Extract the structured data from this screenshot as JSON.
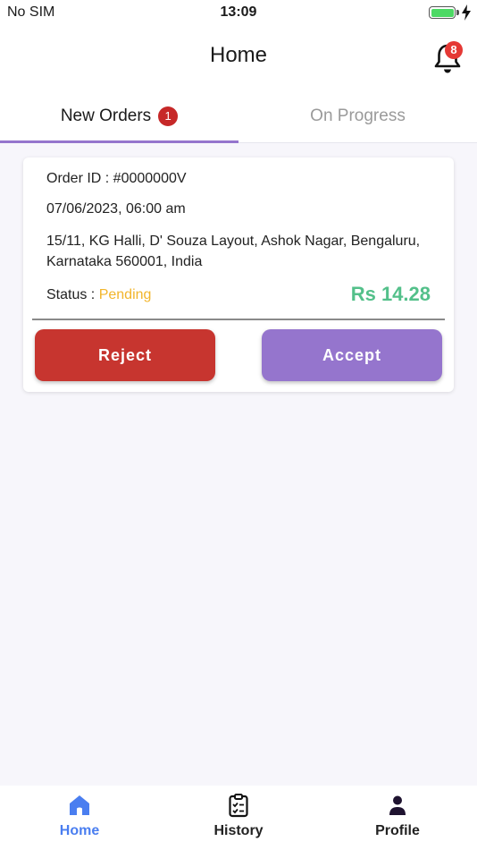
{
  "status_bar": {
    "carrier": "No SIM",
    "time": "13:09"
  },
  "header": {
    "title": "Home",
    "notification_count": "8"
  },
  "tabs": [
    {
      "label": "New Orders",
      "badge": "1",
      "active": true
    },
    {
      "label": "On Progress",
      "active": false
    }
  ],
  "order": {
    "id_text": "Order ID : #0000000V",
    "datetime": "07/06/2023, 06:00 am",
    "address": "15/11, KG Halli, D' Souza Layout, Ashok Nagar, Bengaluru, Karnataka 560001, India",
    "status_label": "Status : ",
    "status_value": "Pending",
    "amount": "Rs 14.28",
    "reject_label": "Reject",
    "accept_label": "Accept"
  },
  "bottom_nav": {
    "items": [
      {
        "label": "Home",
        "icon": "home-icon",
        "active": true
      },
      {
        "label": "History",
        "icon": "clipboard-icon",
        "active": false
      },
      {
        "label": "Profile",
        "icon": "person-icon",
        "active": false
      }
    ]
  },
  "colors": {
    "accent": "#9575cd",
    "reject": "#c7352f",
    "amount": "#53c08a",
    "pending": "#f2b52b",
    "nav_active": "#4a7ef0",
    "badge": "#e53935"
  }
}
